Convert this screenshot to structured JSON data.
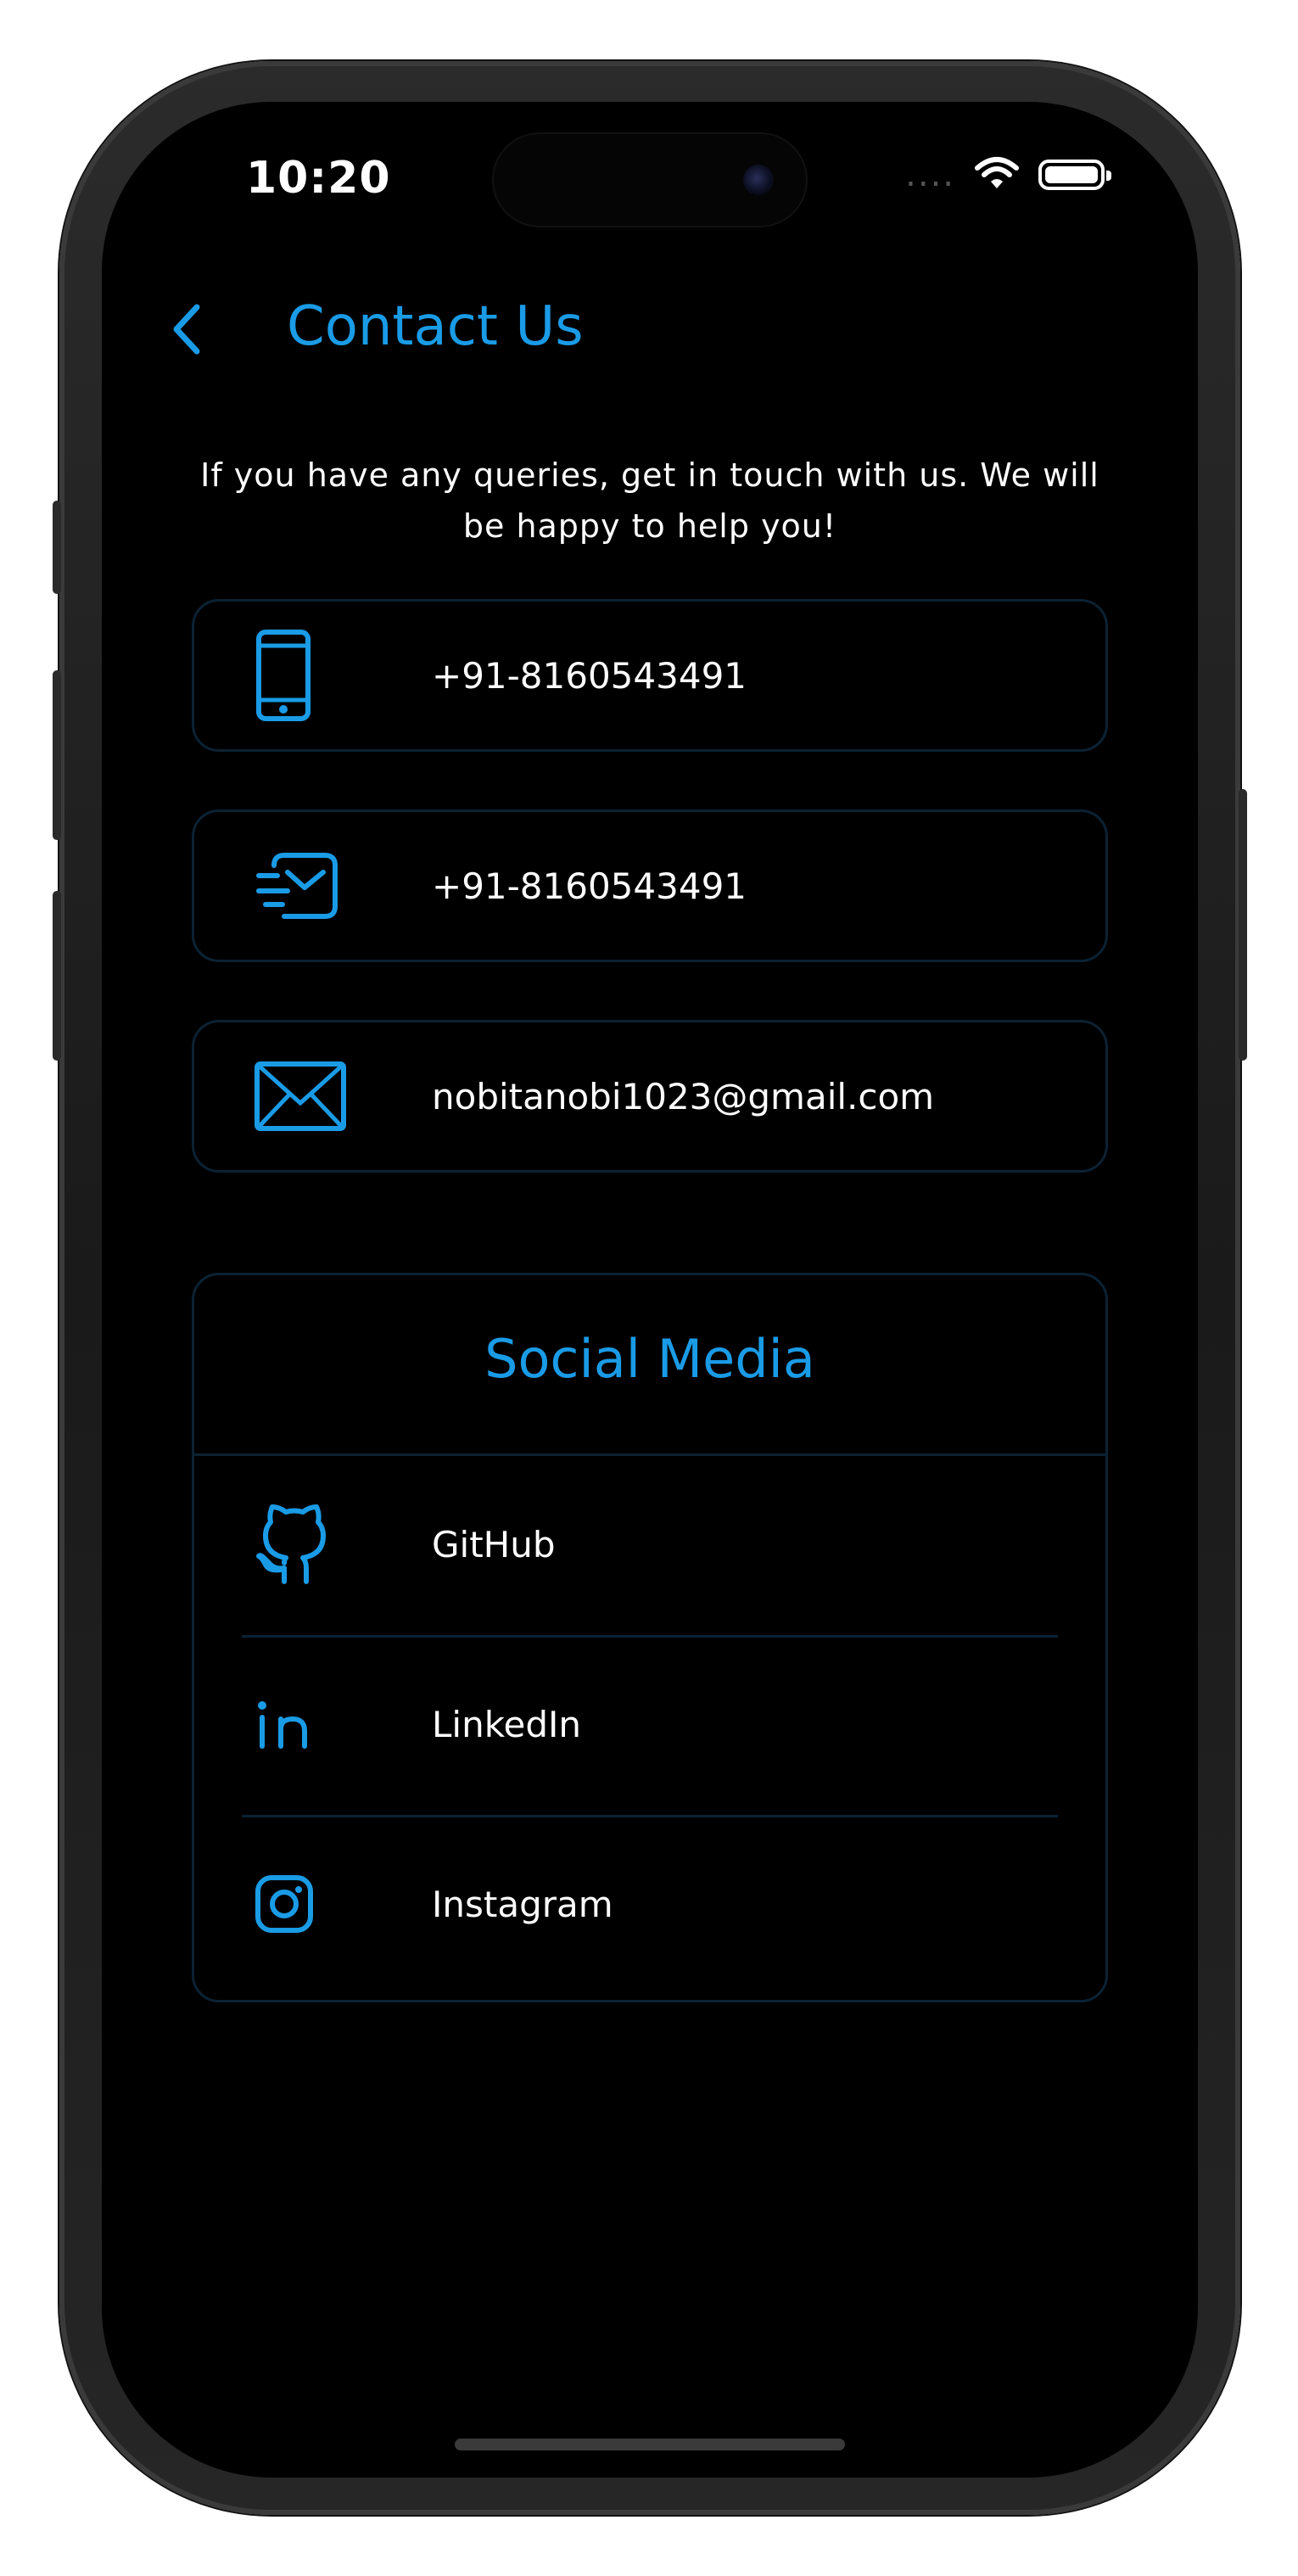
{
  "status_bar": {
    "time": "10:20",
    "signal_dots": "....",
    "wifi_icon": "wifi-icon",
    "battery_icon": "battery-full-icon"
  },
  "header": {
    "back_icon": "chevron-left-icon",
    "title": "Contact Us"
  },
  "intro": {
    "text": "If you have any queries, get in touch with us. We will be happy to help you!"
  },
  "contacts": [
    {
      "icon": "phone-icon",
      "label": "+91-8160543491"
    },
    {
      "icon": "message-icon",
      "label": "+91-8160543491"
    },
    {
      "icon": "email-icon",
      "label": "nobitanobi1023@gmail.com"
    }
  ],
  "social": {
    "title": "Social Media",
    "items": [
      {
        "icon": "github-icon",
        "label": "GitHub"
      },
      {
        "icon": "linkedin-icon",
        "label": "LinkedIn"
      },
      {
        "icon": "instagram-icon",
        "label": "Instagram"
      }
    ]
  },
  "colors": {
    "accent": "#1a9be6",
    "background": "#000000",
    "card_border": "#0b2233",
    "text": "#ffffff"
  }
}
